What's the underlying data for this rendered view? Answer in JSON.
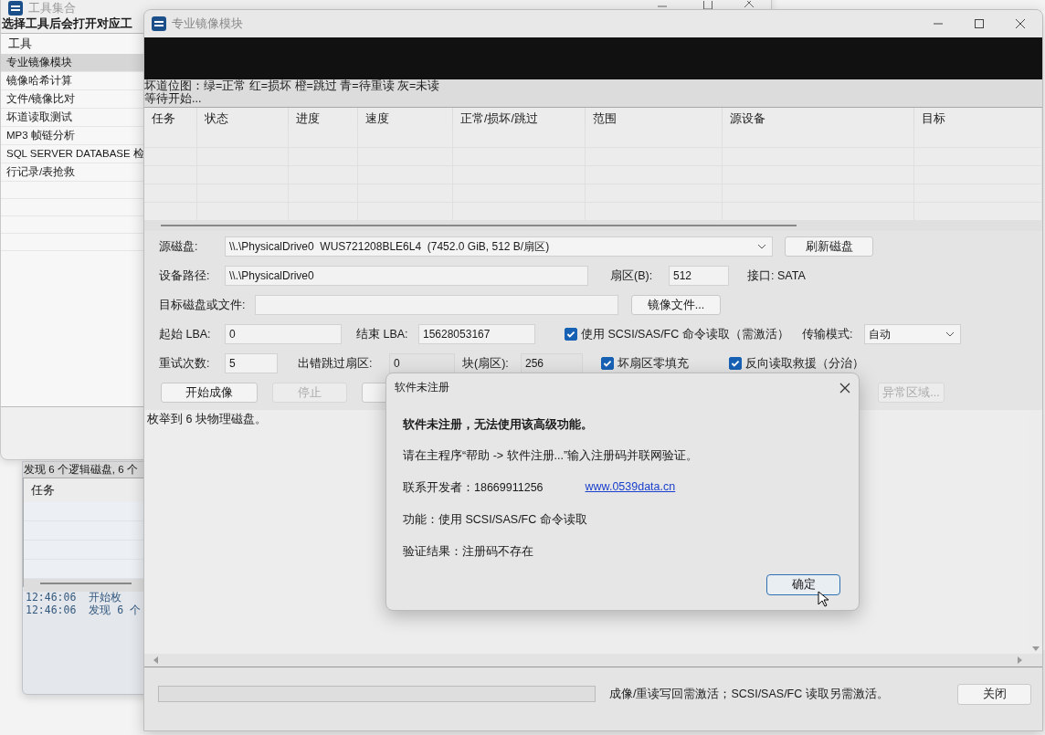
{
  "tool_window": {
    "title": "工具集合",
    "instruction": "选择工具后会打开对应工",
    "list_header": "工具",
    "items": [
      {
        "label": "专业镜像模块",
        "selected": true
      },
      {
        "label": "镜像哈希计算",
        "selected": false
      },
      {
        "label": "文件/镜像比对",
        "selected": false
      },
      {
        "label": "坏道读取测试",
        "selected": false
      },
      {
        "label": "MP3 帧链分析",
        "selected": false
      },
      {
        "label": "SQL SERVER DATABASE 检",
        "selected": false
      },
      {
        "label": "行记录/表抢救",
        "selected": false
      }
    ]
  },
  "task_window": {
    "status": "发现 6 个逻辑磁盘, 6 个",
    "columns": [
      "任务"
    ],
    "log": [
      {
        "time": "12:46:06",
        "message": "开始枚"
      },
      {
        "time": "12:46:06",
        "message": "发现 6 个"
      }
    ]
  },
  "main_window": {
    "title": "专业镜像模块",
    "legend": "坏道位图：绿=正常 红=损坏 橙=跳过 青=待重读 灰=未读",
    "status": "等待开始...",
    "columns": [
      "任务",
      "状态",
      "进度",
      "速度",
      "正常/损坏/跳过",
      "范围",
      "源设备",
      "目标"
    ],
    "form": [
      [
        {
          "kind": "label",
          "text": "源磁盘:"
        },
        {
          "kind": "select",
          "value": "\\\\.\\PhysicalDrive0  WUS721208BLE6L4  (7452.0 GiB, 512 B/扇区)"
        },
        {
          "kind": "button",
          "text": "刷新磁盘"
        }
      ],
      [
        {
          "kind": "label",
          "text": "设备路径:"
        },
        {
          "kind": "input",
          "value": "\\\\.\\PhysicalDrive0",
          "disabled": false
        },
        {
          "kind": "label",
          "text": "扇区(B):"
        },
        {
          "kind": "input",
          "value": "512",
          "disabled": false
        },
        {
          "kind": "label",
          "text": "接口: SATA"
        }
      ],
      [
        {
          "kind": "label",
          "text": "目标磁盘或文件:"
        },
        {
          "kind": "input",
          "disabled": false
        },
        {
          "kind": "button",
          "text": "镜像文件..."
        }
      ],
      [
        {
          "kind": "label",
          "text": "起始 LBA:"
        },
        {
          "kind": "input",
          "value": "0",
          "disabled": false
        },
        {
          "kind": "label",
          "text": "结束 LBA:"
        },
        {
          "kind": "input",
          "value": "15628053167",
          "disabled": false
        },
        {
          "kind": "checkbox",
          "text": "使用 SCSI/SAS/FC 命令读取（需激活）",
          "checked": true
        },
        {
          "kind": "label",
          "text": "传输模式:"
        },
        {
          "kind": "select",
          "value": "自动"
        }
      ],
      [
        {
          "kind": "label",
          "text": "重试次数:"
        },
        {
          "kind": "input",
          "value": "5",
          "disabled": false
        },
        {
          "kind": "label",
          "text": "出错跳过扇区:"
        },
        {
          "kind": "input",
          "value": "0",
          "disabled": true
        },
        {
          "kind": "label",
          "text": "块(扇区):"
        },
        {
          "kind": "input",
          "value": "256",
          "disabled": true
        },
        {
          "kind": "checkbox",
          "text": "坏扇区零填充",
          "checked": true
        },
        {
          "kind": "checkbox",
          "text": "反向读取救援（分治）",
          "checked": true
        }
      ]
    ],
    "buttons": [
      {
        "text": "开始成像",
        "disabled": false
      },
      {
        "text": "停止",
        "disabled": true
      },
      {
        "disabled": false
      },
      {
        "text": "异常区域...",
        "disabled": true
      }
    ],
    "log": [
      "枚举到 6 块物理磁盘。"
    ],
    "progress": {
      "level": 0
    },
    "note": "成像/重读写回需激活；SCSI/SAS/FC 读取另需激活。",
    "close_button": "关闭"
  },
  "dialog": {
    "title": "软件未注册",
    "heading": "软件未注册，无法使用该高级功能。",
    "instruction": "请在主程序“帮助 -> 软件注册...”输入注册码并联网验证。",
    "contact_label": "联系开发者：18669911256",
    "link": "www.0539data.cn",
    "feature": "功能：使用 SCSI/SAS/FC 命令读取",
    "result": "验证结果：注册码不存在",
    "ok_button": "确定"
  }
}
